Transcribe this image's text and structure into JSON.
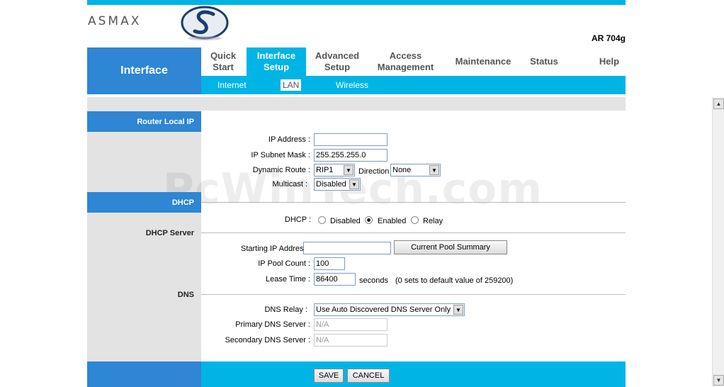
{
  "brand": {
    "logo_text": "ASMAX",
    "model": "AR 704g"
  },
  "side_title": "Interface",
  "nav": [
    {
      "l1": "Quick",
      "l2": "Start"
    },
    {
      "l1": "Interface",
      "l2": "Setup"
    },
    {
      "l1": "Advanced",
      "l2": "Setup"
    },
    {
      "l1": "Access",
      "l2": "Management"
    },
    {
      "l1": "Maintenance",
      "l2": ""
    },
    {
      "l1": "Status",
      "l2": ""
    },
    {
      "l1": "Help",
      "l2": ""
    }
  ],
  "subnav": [
    "Internet",
    "LAN",
    "Wireless"
  ],
  "sections": {
    "router_local_ip": "Router Local IP",
    "dhcp": "DHCP",
    "dhcp_server": "DHCP Server",
    "dns": "DNS"
  },
  "router": {
    "ip_address_label": "IP Address :",
    "ip_address_value": "",
    "subnet_label": "IP Subnet Mask :",
    "subnet_value": "255.255.255.0",
    "dynamic_route_label": "Dynamic Route :",
    "dynamic_route_value": "RIP1",
    "direction_label": "Direction",
    "direction_value": "None",
    "multicast_label": "Multicast :",
    "multicast_value": "Disabled"
  },
  "dhcp": {
    "label": "DHCP :",
    "options": [
      "Disabled",
      "Enabled",
      "Relay"
    ],
    "selected": "Enabled"
  },
  "dhcp_server": {
    "start_ip_label": "Starting IP Address",
    "start_ip_value": "",
    "pool_summary_button": "Current Pool Summary",
    "pool_count_label": "IP Pool Count :",
    "pool_count_value": "100",
    "lease_label": "Lease Time :",
    "lease_value": "86400",
    "lease_unit": "seconds",
    "lease_note": "(0 sets to default value of 259200)"
  },
  "dns": {
    "relay_label": "DNS Relay :",
    "relay_value": "Use Auto Discovered DNS Server Only",
    "primary_label": "Primary DNS Server :",
    "primary_value": "N/A",
    "secondary_label": "Secondary DNS Server :",
    "secondary_value": "N/A"
  },
  "buttons": {
    "save": "SAVE",
    "cancel": "CANCEL"
  },
  "watermark": "PcWinTech.com",
  "colors": {
    "primary_blue": "#2e86d4",
    "cyan": "#00b4e6",
    "panel_gray": "#e3e3e3"
  }
}
